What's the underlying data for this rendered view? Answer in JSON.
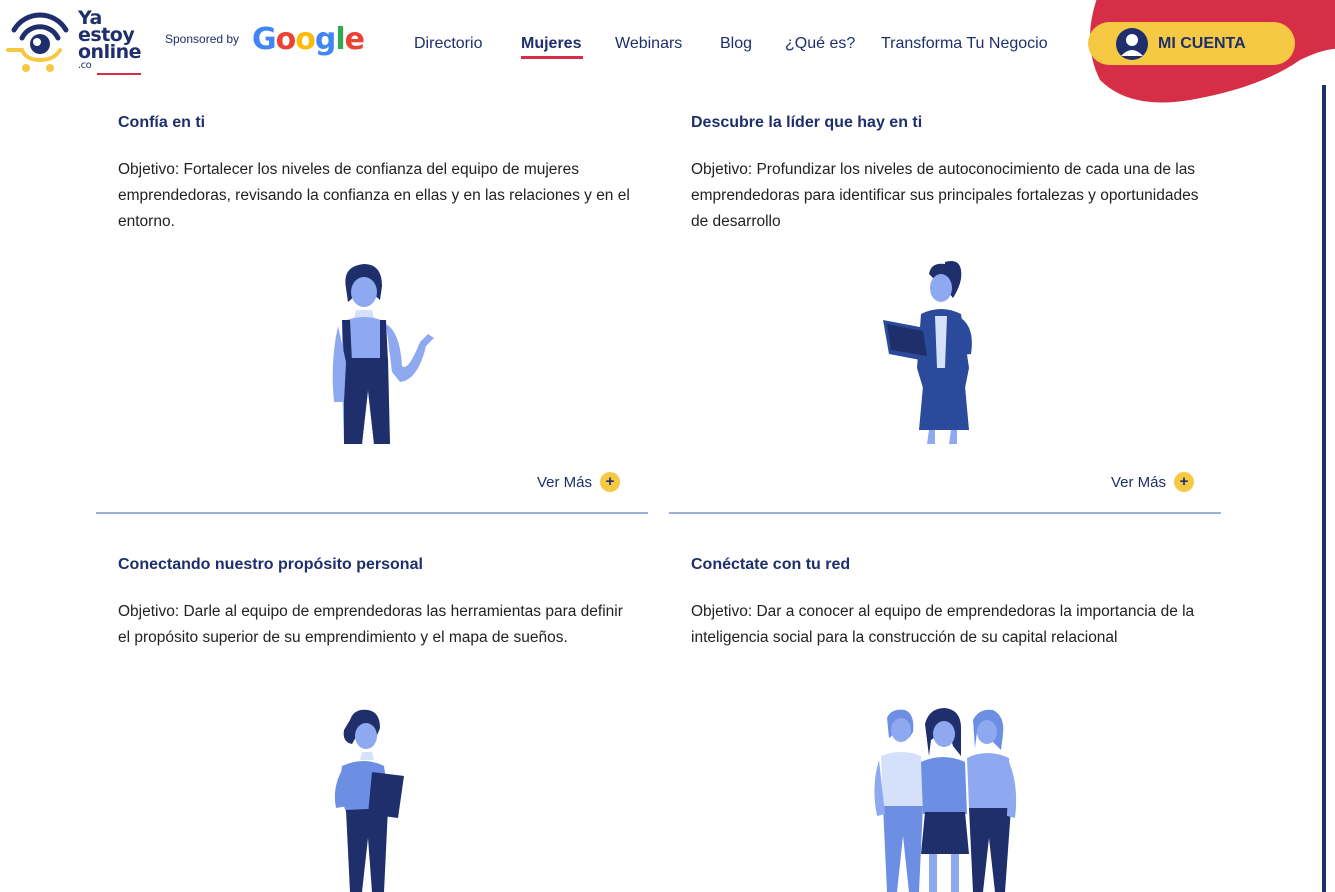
{
  "brand": {
    "logo_line1": "Ya",
    "logo_line2": "estoy",
    "logo_line3": "online",
    "logo_line4": ".co",
    "sponsored_label": "Sponsored by",
    "sponsor_letters": [
      "G",
      "o",
      "o",
      "g",
      "l",
      "e"
    ]
  },
  "nav": {
    "items": [
      {
        "label": "Directorio"
      },
      {
        "label": "Mujeres"
      },
      {
        "label": "Webinars"
      },
      {
        "label": "Blog"
      },
      {
        "label": "¿Qué es?"
      },
      {
        "label": "Transforma Tu Negocio"
      }
    ],
    "active_item": "Mujeres",
    "account_label": "MI CUENTA"
  },
  "colors": {
    "navy": "#1e2f6b",
    "accent_red": "#d62e46",
    "accent_yellow": "#f6c945",
    "figure_blue": "#8ea9ef",
    "divider": "#9fb0d4"
  },
  "cards": [
    {
      "title": "Confía en ti",
      "description": "Objetivo: Fortalecer los niveles de confianza del equipo de mujeres emprendedoras, revisando la confianza en ellas y en las relaciones y en el entorno.",
      "more_label": "Ver Más",
      "illustration": "woman-overalls-icon"
    },
    {
      "title": "Descubre la líder que hay en ti",
      "description": "Objetivo: Profundizar los niveles de autoconocimiento de cada una de las emprendedoras para identificar sus principales fortalezas y oportunidades de desarrollo",
      "more_label": "Ver Más",
      "illustration": "woman-laptop-icon"
    },
    {
      "title": "Conectando nuestro propósito personal",
      "description": "Objetivo: Darle al equipo de emprendedoras las herramientas para definir el propósito superior de su emprendimiento y el mapa de sueños.",
      "illustration": "woman-clipboard-icon"
    },
    {
      "title": "Conéctate con tu red",
      "description": "Objetivo: Dar a conocer al equipo de emprendedoras la importancia de la inteligencia social para la construcción de su capital relacional",
      "illustration": "three-women-icon"
    }
  ]
}
